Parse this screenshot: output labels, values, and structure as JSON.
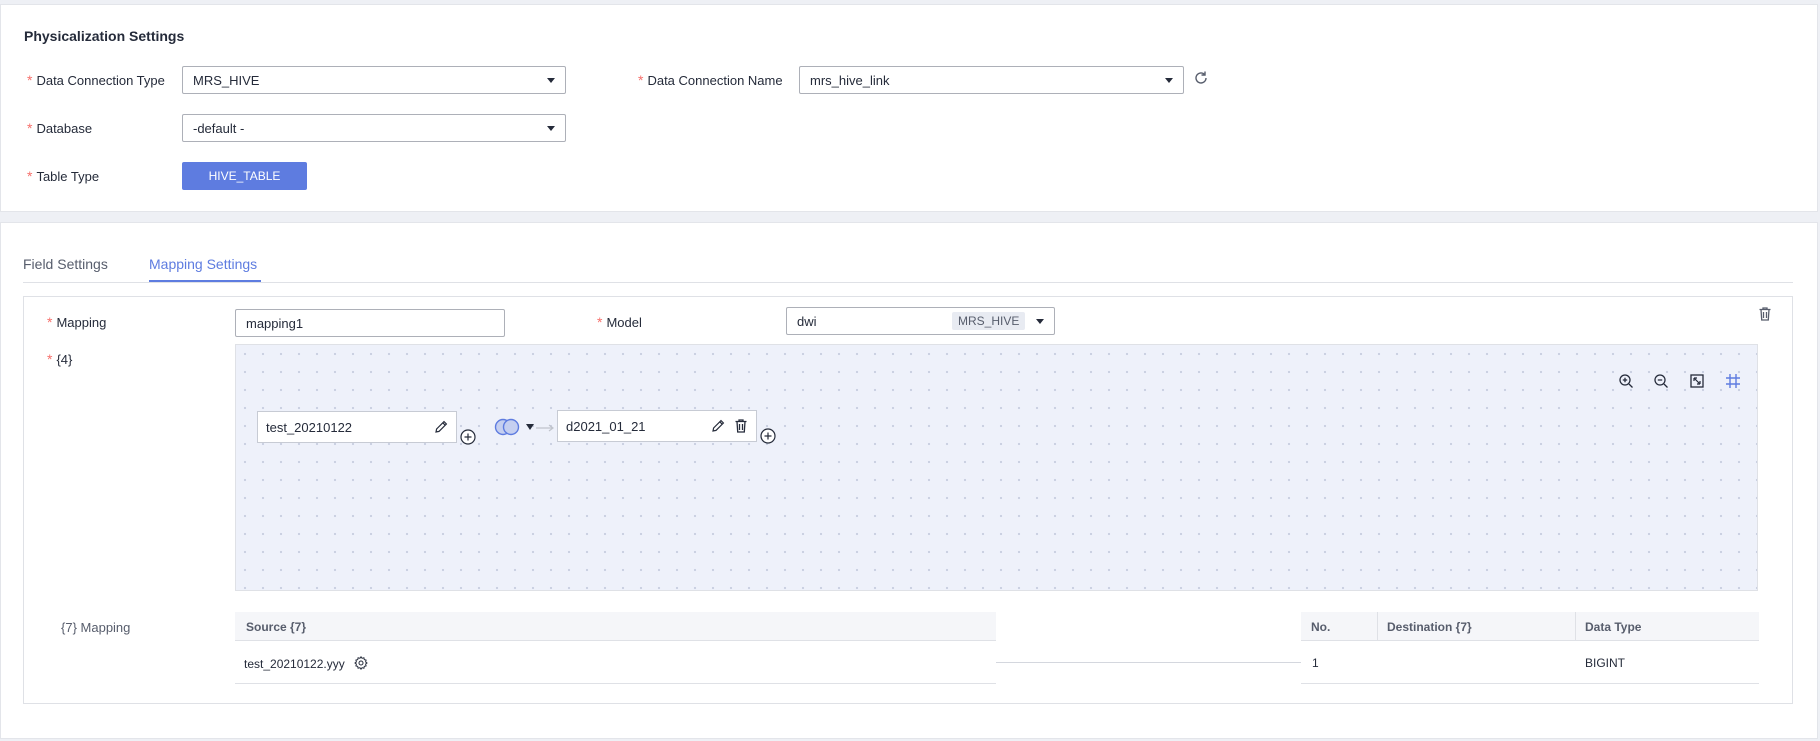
{
  "physicalization": {
    "title": "Physicalization Settings",
    "data_connection_type_label": "Data Connection Type",
    "data_connection_type_value": "MRS_HIVE",
    "data_connection_name_label": "Data Connection Name",
    "data_connection_name_value": "mrs_hive_link",
    "database_label": "Database",
    "database_value": "-default -",
    "table_type_label": "Table Type",
    "table_type_value": "HIVE_TABLE",
    "required_mark": "*"
  },
  "tabs": [
    {
      "label": "Field Settings",
      "active": false
    },
    {
      "label": "Mapping Settings",
      "active": true
    }
  ],
  "mapping": {
    "mapping_label": "Mapping",
    "mapping_value": "mapping1",
    "model_label": "Model",
    "model_value": "dwi",
    "model_badge": "MRS_HIVE",
    "canvas_label": "{4}",
    "nodes": [
      {
        "name": "test_20210122"
      },
      {
        "name": "d2021_01_21"
      }
    ],
    "canvas_tools": [
      "zoom-in-icon",
      "zoom-out-icon",
      "fit-screen-icon",
      "grid-icon"
    ]
  },
  "field_mapping": {
    "label": "{7} Mapping",
    "source_header": "Source {7}",
    "source_rows": [
      "test_20210122.yyy"
    ],
    "dest_headers": [
      "No.",
      "Destination {7}",
      "Data Type"
    ],
    "dest_rows": [
      {
        "no": "1",
        "destination": "",
        "data_type": "BIGINT"
      }
    ]
  },
  "colors": {
    "primary": "#5e7ce0",
    "required": "#f66f6a",
    "canvas_bg": "#eef1fa"
  }
}
